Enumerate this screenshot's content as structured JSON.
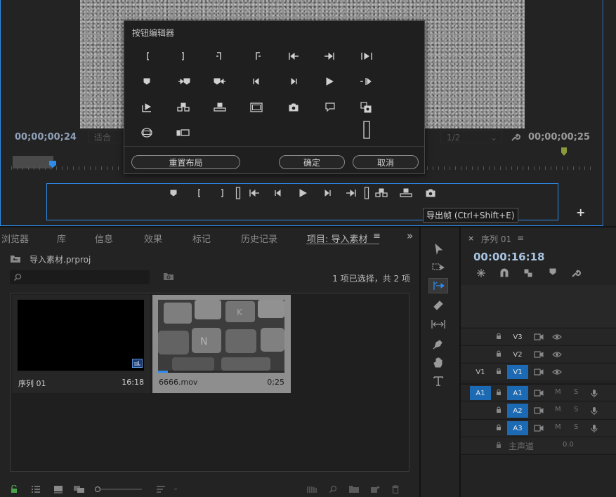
{
  "monitor": {
    "timecode_left": "00;00;00;24",
    "fit_label": "适合",
    "resolution": "1/2",
    "timecode_right": "00;00;00;25",
    "tooltip": "导出帧 (Ctrl+Shift+E)",
    "add_button": "+"
  },
  "dialog": {
    "title": "按钮编辑器",
    "reset_layout": "重置布局",
    "ok": "确定",
    "cancel": "取消"
  },
  "project": {
    "tabs": [
      "浏览器",
      "库",
      "信息",
      "效果",
      "标记",
      "历史记录",
      "项目: 导入素材"
    ],
    "menu_glyph": "≡",
    "overflow_glyph": "»",
    "file_name": "导入素材.prproj",
    "selection_info": "1 项已选择，共 2 项",
    "items": [
      {
        "name": "序列 01",
        "duration": "16:18"
      },
      {
        "name": "6666.mov",
        "duration": "0;25"
      }
    ]
  },
  "timeline": {
    "close_glyph": "×",
    "title": "序列 01",
    "menu_glyph": "≡",
    "timecode": "00:00:16:18",
    "video_tracks": [
      "V3",
      "V2",
      "V1"
    ],
    "video_source": "V1",
    "audio_tracks": [
      "A1",
      "A2",
      "A3"
    ],
    "audio_source": "A1",
    "mute": "M",
    "solo": "S",
    "master_label": "主声道",
    "master_value": "0.0"
  },
  "colors": {
    "accent": "#2d8ceb",
    "track_on": "#1c6ab4",
    "panel_bg": "#232323"
  }
}
